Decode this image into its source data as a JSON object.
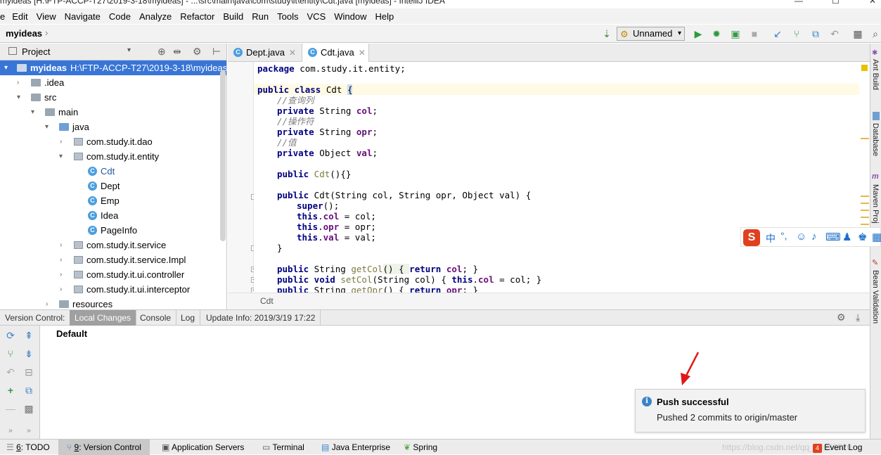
{
  "window": {
    "title": "myideas [H:\\FTP-ACCP-T27\\2019-3-18\\myideas] - ...\\src\\main\\java\\com\\study\\it\\entity\\Cdt.java [myideas] - IntelliJ IDEA"
  },
  "menu": [
    "Edit",
    "View",
    "Navigate",
    "Code",
    "Analyze",
    "Refactor",
    "Build",
    "Run",
    "Tools",
    "VCS",
    "Window",
    "Help"
  ],
  "menu_first": "e",
  "navbar": {
    "project": "myideas",
    "run_config": "Unnamed"
  },
  "project_panel": {
    "title": "Project",
    "tree": [
      {
        "label": "myideas",
        "extra": "H:\\FTP-ACCP-T27\\2019-3-18\\myideas"
      },
      {
        "label": ".idea"
      },
      {
        "label": "src"
      },
      {
        "label": "main"
      },
      {
        "label": "java"
      },
      {
        "label": "com.study.it.dao"
      },
      {
        "label": "com.study.it.entity"
      },
      {
        "label": "Cdt"
      },
      {
        "label": "Dept"
      },
      {
        "label": "Emp"
      },
      {
        "label": "Idea"
      },
      {
        "label": "PageInfo"
      },
      {
        "label": "com.study.it.service"
      },
      {
        "label": "com.study.it.service.Impl"
      },
      {
        "label": "com.study.it.ui.controller"
      },
      {
        "label": "com.study.it.ui.interceptor"
      },
      {
        "label": "resources"
      }
    ]
  },
  "editor": {
    "tabs": [
      {
        "label": "Dept.java"
      },
      {
        "label": "Cdt.java"
      }
    ],
    "breadcrumb": "Cdt",
    "lines": {
      "l0_a": "package",
      "l0_b": " com.study.it.entity;",
      "l1_a": "public class",
      "l1_b": " Cdt ",
      "l1_c": "{",
      "l2": "//查询列",
      "l3_a": "private",
      "l3_b": " String ",
      "l3_c": "col",
      "l3_d": ";",
      "l4": "//操作符",
      "l5_a": "private",
      "l5_b": " String ",
      "l5_c": "opr",
      "l5_d": ";",
      "l6": "//值",
      "l7_a": "private",
      "l7_b": " Object ",
      "l7_c": "val",
      "l7_d": ";",
      "l8_a": "public",
      "l8_b": " Cdt",
      "l8_c": "(){}",
      "l9_a": "public",
      "l9_b": " Cdt(String col, String opr, Object val) {",
      "l10_a": "super",
      "l10_b": "();",
      "l11_a": "this",
      "l11_b": ".",
      "l11_c": "col",
      "l11_d": " = col;",
      "l12_a": "this",
      "l12_b": ".",
      "l12_c": "opr",
      "l12_d": " = opr;",
      "l13_a": "this",
      "l13_b": ".",
      "l13_c": "val",
      "l13_d": " = val;",
      "l14": "}",
      "l15_a": "public",
      "l15_b": " String ",
      "l15_c": "getCol",
      "l15_d": "() { ",
      "l15_e": "return",
      "l15_f": " ",
      "l15_g": "col",
      "l15_h": "; }",
      "l16_a": "public void",
      "l16_b": " ",
      "l16_c": "setCol",
      "l16_d": "(String col) { ",
      "l16_e": "this",
      "l16_f": ".",
      "l16_g": "col",
      "l16_h": " = col; }",
      "l17_a": "public",
      "l17_b": " String ",
      "l17_c": "getOpr",
      "l17_d": "() { ",
      "l17_e": "return",
      "l17_f": " ",
      "l17_g": "opr",
      "l17_h": "; }"
    }
  },
  "right_tools": [
    "Ant Build",
    "Database",
    "Maven Proj",
    "Bean Validation"
  ],
  "version_control": {
    "label": "Version Control:",
    "tabs": [
      "Local Changes",
      "Console",
      "Log",
      "Update Info: 2019/3/19 17:22"
    ],
    "group": "Default"
  },
  "notification": {
    "title": "Push successful",
    "body": "Pushed 2 commits to origin/master"
  },
  "statusbar": {
    "tabs": [
      {
        "num": "6",
        "label": ": TODO"
      },
      {
        "num": "9",
        "label": ": Version Control"
      },
      {
        "num": "",
        "label": "Application Servers"
      },
      {
        "num": "",
        "label": "Terminal"
      },
      {
        "num": "",
        "label": "Java Enterprise"
      },
      {
        "num": "",
        "label": "Spring"
      }
    ],
    "event_log_count": "4",
    "event_log": "Event Log",
    "watermark": "https://blog.csdn.net/qq_44666520"
  },
  "ime": {
    "logo": "S",
    "lang": "中"
  },
  "colors": {
    "selection": "#3875d7",
    "keyword": "#000080",
    "field": "#660e7a",
    "comment": "#808080",
    "accent_red": "#e0401e"
  }
}
